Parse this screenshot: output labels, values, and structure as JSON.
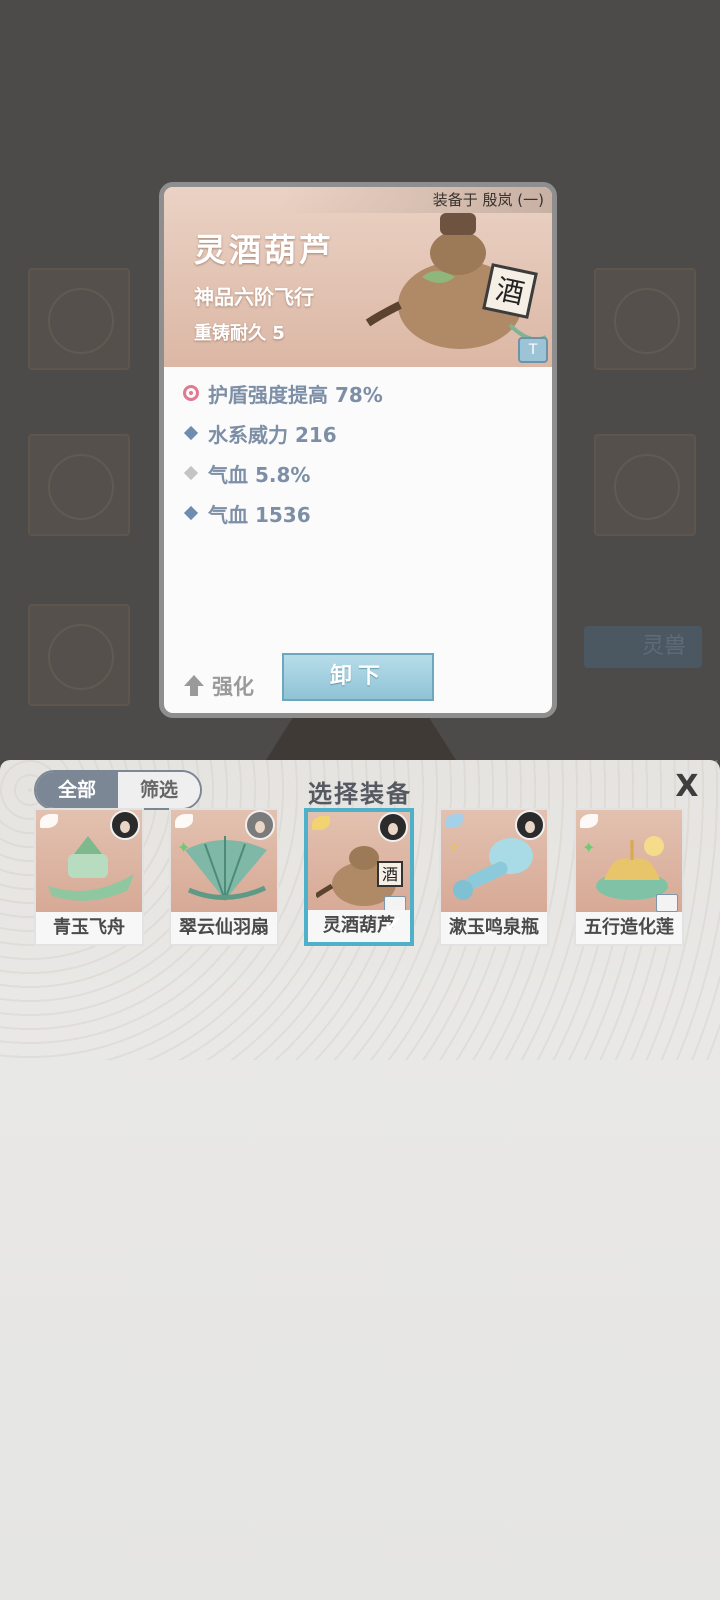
{
  "detail": {
    "equipped_on": "装备于 殷岚 (一)",
    "name": "灵酒葫芦",
    "grade": "神品六阶飞行",
    "durability": "重铸耐久 5",
    "stats": [
      {
        "icon": "drop-icon",
        "text": "护盾强度提高 78%"
      },
      {
        "icon": "diamond-blue-icon",
        "text": "水系威力 216"
      },
      {
        "icon": "diamond-grey-icon",
        "text": "气血 5.8%"
      },
      {
        "icon": "diamond-blue-icon",
        "text": "气血 1536"
      }
    ],
    "enhance_label": "强化",
    "unequip_label": "卸下",
    "forge_badge": "T"
  },
  "background": {
    "lingshou_label": "灵兽"
  },
  "panel": {
    "title": "选择装备",
    "tabs": [
      {
        "label": "全部",
        "active": true
      },
      {
        "label": "筛选",
        "active": false
      }
    ],
    "close": "X",
    "items": [
      {
        "name": "青玉飞舟",
        "selected": false
      },
      {
        "name": "翠云仙羽扇",
        "selected": false
      },
      {
        "name": "灵酒葫芦",
        "selected": true,
        "check": "✔"
      },
      {
        "name": "漱玉鸣泉瓶",
        "selected": false
      },
      {
        "name": "五行造化莲",
        "selected": false
      }
    ]
  },
  "colors": {
    "accent_blue": "#4fb0c9",
    "stat_text": "#7d8fa6",
    "tab_active": "#7c8796"
  }
}
